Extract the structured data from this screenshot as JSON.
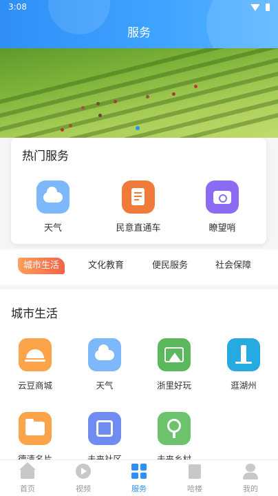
{
  "status_bar": {
    "time": "3:08"
  },
  "header": {
    "title": "服务"
  },
  "hot_services": {
    "title": "热门服务",
    "items": [
      {
        "label": "天气",
        "icon": "weather-cloud-icon",
        "color": "#7db8fb"
      },
      {
        "label": "民意直通车",
        "icon": "document-edit-icon",
        "color": "#f07a3a"
      },
      {
        "label": "瞭望哨",
        "icon": "camera-icon",
        "color": "#8a6bf2"
      }
    ]
  },
  "category_tabs": [
    {
      "label": "城市生活",
      "active": true
    },
    {
      "label": "文化教育",
      "active": false
    },
    {
      "label": "便民服务",
      "active": false
    },
    {
      "label": "社会保障",
      "active": false
    }
  ],
  "city_life": {
    "title": "城市生活",
    "items": [
      {
        "label": "云豆商城",
        "icon": "cloche-icon",
        "color": "#fba44a"
      },
      {
        "label": "天气",
        "icon": "weather-cloud-icon",
        "color": "#7db8fb"
      },
      {
        "label": "浙里好玩",
        "icon": "mountain-picture-icon",
        "color": "#5cb85c"
      },
      {
        "label": "逛湖州",
        "icon": "tower-icon",
        "color": "#27a9e1"
      },
      {
        "label": "德清名片",
        "icon": "folder-card-icon",
        "color": "#fba44a"
      },
      {
        "label": "未来社区",
        "icon": "house-icon",
        "color": "#6f8df0"
      },
      {
        "label": "未来乡村",
        "icon": "tree-icon",
        "color": "#6cc36c"
      }
    ]
  },
  "bottom_nav": [
    {
      "label": "首页",
      "icon": "home-icon",
      "active": false
    },
    {
      "label": "视频",
      "icon": "play-icon",
      "active": false
    },
    {
      "label": "服务",
      "icon": "grid-icon",
      "active": true
    },
    {
      "label": "哈楼",
      "icon": "building-icon",
      "active": false
    },
    {
      "label": "我的",
      "icon": "user-icon",
      "active": false
    }
  ],
  "colors": {
    "primary": "#2f8ff7",
    "active_tab_start": "#ff9f5a",
    "active_tab_end": "#f3634a"
  }
}
